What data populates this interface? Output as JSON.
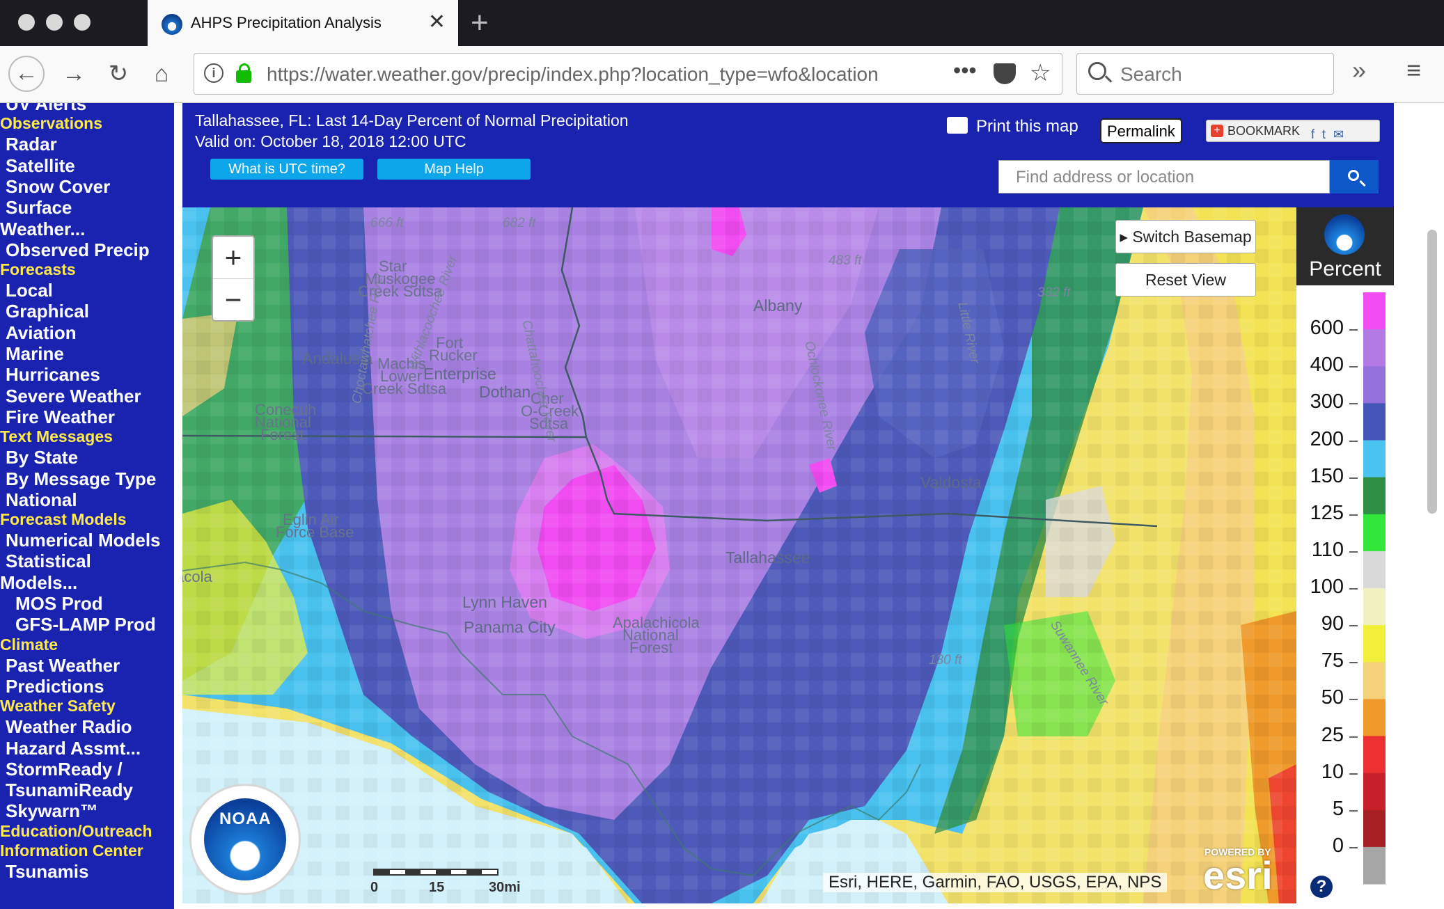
{
  "browser": {
    "tab_title": "AHPS Precipitation Analysis",
    "url": "https://water.weather.gov/precip/index.php?location_type=wfo&location",
    "search_placeholder": "Search"
  },
  "sidebar": [
    {
      "label": "UV Alerts",
      "kind": "item"
    },
    {
      "label": "Observations",
      "kind": "head"
    },
    {
      "label": "Radar",
      "kind": "item"
    },
    {
      "label": "Satellite",
      "kind": "item"
    },
    {
      "label": "Snow Cover",
      "kind": "item"
    },
    {
      "label": "Surface",
      "kind": "item"
    },
    {
      "label": "Weather...",
      "kind": "wrap"
    },
    {
      "label": "Observed Precip",
      "kind": "item"
    },
    {
      "label": "Forecasts",
      "kind": "head"
    },
    {
      "label": "Local",
      "kind": "item"
    },
    {
      "label": "Graphical",
      "kind": "item"
    },
    {
      "label": "Aviation",
      "kind": "item"
    },
    {
      "label": "Marine",
      "kind": "item"
    },
    {
      "label": "Hurricanes",
      "kind": "item"
    },
    {
      "label": "Severe Weather",
      "kind": "item"
    },
    {
      "label": "Fire Weather",
      "kind": "item"
    },
    {
      "label": "Text Messages",
      "kind": "head"
    },
    {
      "label": "By State",
      "kind": "item"
    },
    {
      "label": "By Message Type",
      "kind": "item"
    },
    {
      "label": "National",
      "kind": "item"
    },
    {
      "label": "Forecast Models",
      "kind": "head"
    },
    {
      "label": "Numerical Models",
      "kind": "item"
    },
    {
      "label": "Statistical",
      "kind": "item"
    },
    {
      "label": "Models...",
      "kind": "wrap"
    },
    {
      "label": "MOS Prod",
      "kind": "sub"
    },
    {
      "label": "GFS-LAMP Prod",
      "kind": "sub"
    },
    {
      "label": "Climate",
      "kind": "head"
    },
    {
      "label": "Past Weather",
      "kind": "item"
    },
    {
      "label": "Predictions",
      "kind": "item"
    },
    {
      "label": "Weather Safety",
      "kind": "head"
    },
    {
      "label": "Weather Radio",
      "kind": "item"
    },
    {
      "label": "Hazard Assmt...",
      "kind": "item"
    },
    {
      "label": "StormReady /",
      "kind": "item"
    },
    {
      "label": "TsunamiReady",
      "kind": "item"
    },
    {
      "label": "Skywarn™",
      "kind": "item"
    },
    {
      "label": "Education/Outreach",
      "kind": "head"
    },
    {
      "label": "Information Center",
      "kind": "head"
    },
    {
      "label": "Tsunamis",
      "kind": "item"
    }
  ],
  "header": {
    "title": "Tallahassee, FL: Last 14-Day Percent of Normal Precipitation",
    "valid": "Valid on: October 18, 2018 12:00 UTC",
    "utc_button": "What is UTC time?",
    "help_button": "Map Help",
    "print": "Print this map",
    "permalink": "Permalink",
    "bookmark": "BOOKMARK",
    "find_placeholder": "Find address or location"
  },
  "map": {
    "switch_basemap": "Switch Basemap",
    "reset_view": "Reset View",
    "attribution": "Esri, HERE, Garmin, FAO, USGS, EPA, NPS",
    "scale": [
      "0",
      "15",
      "30mi"
    ],
    "noaa": "NOAA",
    "esri_powered": "POWERED BY",
    "esri": "esri",
    "labels": [
      {
        "text": "Andalusia",
        "style": "big"
      },
      {
        "text": "Machis",
        "style": "plain"
      },
      {
        "text": "Lower",
        "style": "plain"
      },
      {
        "text": "Creek Sdtsa",
        "style": "plain"
      },
      {
        "text": "Fort",
        "style": "plain"
      },
      {
        "text": "Rucker",
        "style": "plain"
      },
      {
        "text": "Enterprise",
        "style": "big"
      },
      {
        "text": "Dothan",
        "style": "big"
      },
      {
        "text": "Cher",
        "style": "plain"
      },
      {
        "text": "O-Creek",
        "style": "plain"
      },
      {
        "text": "Sdtsa",
        "style": "plain"
      },
      {
        "text": "Star",
        "style": "plain"
      },
      {
        "text": "Muskogee",
        "style": "plain"
      },
      {
        "text": "Creek Sdtsa",
        "style": "plain"
      },
      {
        "text": "Albany",
        "style": "big"
      },
      {
        "text": "Valdosta",
        "style": "big"
      },
      {
        "text": "Tallahassee",
        "style": "big"
      },
      {
        "text": "Lynn Haven",
        "style": "big"
      },
      {
        "text": "Panama City",
        "style": "big"
      },
      {
        "text": "Eglin Air",
        "style": "plain"
      },
      {
        "text": "Force Base",
        "style": "plain"
      },
      {
        "text": "Apalachicola",
        "style": "plain"
      },
      {
        "text": "National",
        "style": "plain"
      },
      {
        "text": "Forest",
        "style": "plain"
      },
      {
        "text": "Conecuh",
        "style": "plain"
      },
      {
        "text": "National",
        "style": "plain"
      },
      {
        "text": "Forest",
        "style": "plain"
      },
      {
        "text": "Pensacola",
        "style": "plain"
      },
      {
        "text": "666 ft",
        "style": "it"
      },
      {
        "text": "682 ft",
        "style": "it"
      },
      {
        "text": "483 ft",
        "style": "it"
      },
      {
        "text": "332 ft",
        "style": "it"
      },
      {
        "text": "130 ft",
        "style": "it"
      },
      {
        "text": "Choctawhatchee River",
        "style": "it"
      },
      {
        "text": "Chattahoochee River",
        "style": "it"
      },
      {
        "text": "Withlacoochee River",
        "style": "it"
      },
      {
        "text": "Little River",
        "style": "it"
      },
      {
        "text": "Suwannee River",
        "style": "it"
      },
      {
        "text": "Ochlockonee River",
        "style": "it"
      }
    ]
  },
  "legend": {
    "title": "Percent",
    "values": [
      "600",
      "400",
      "300",
      "200",
      "150",
      "125",
      "110",
      "100",
      "90",
      "75",
      "50",
      "25",
      "10",
      "5",
      "0"
    ],
    "colors": [
      "#f14bf2",
      "#b37ae6",
      "#9370db",
      "#4456b8",
      "#4ac3f0",
      "#2f8f45",
      "#32e63a",
      "#d9d9d9",
      "#f1f1c2",
      "#f2ef3a",
      "#f5d27a",
      "#ef9a2b",
      "#ec2f31",
      "#c8202a",
      "#a51f22",
      "#a6a6a6"
    ],
    "help": "?"
  }
}
